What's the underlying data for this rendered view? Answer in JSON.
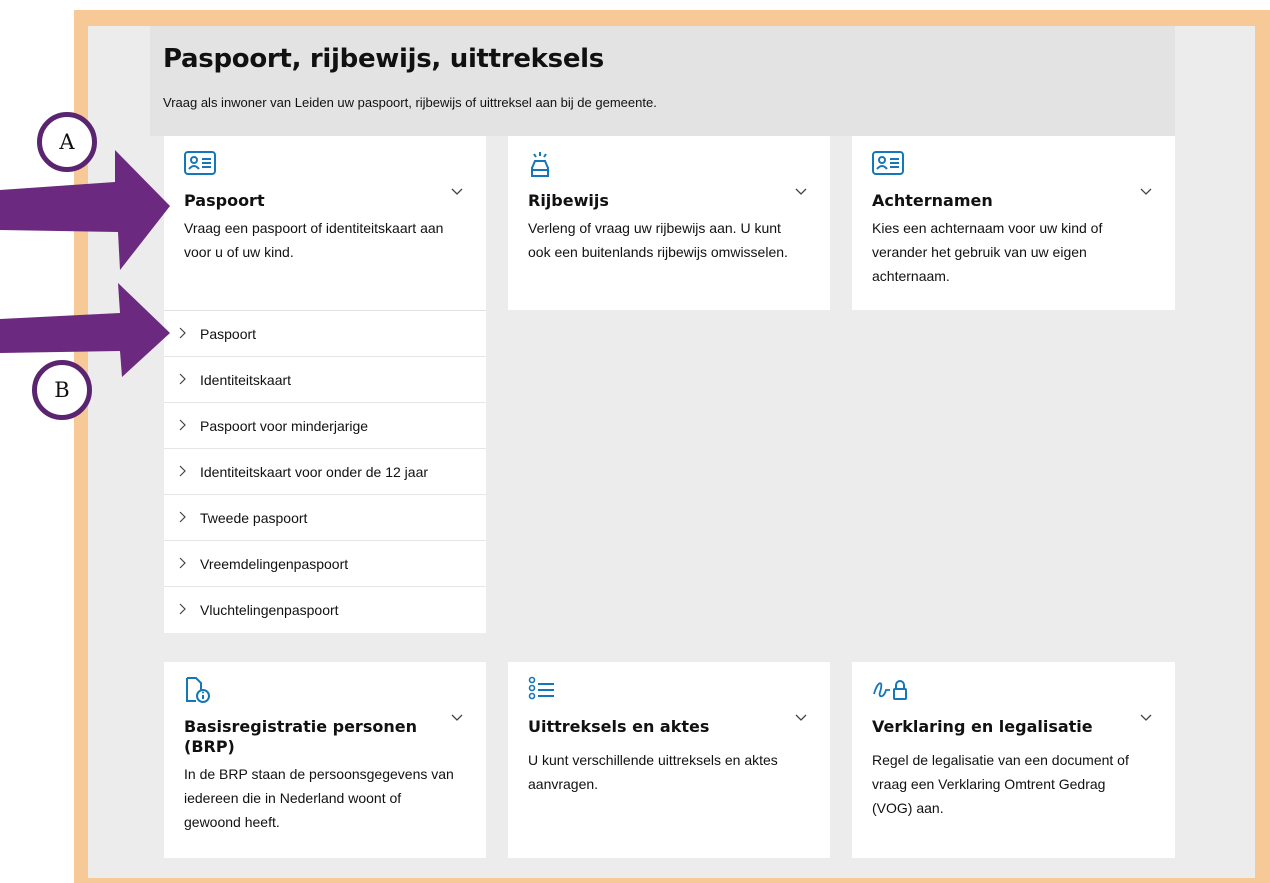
{
  "page": {
    "title": "Paspoort, rijbewijs, uittreksels",
    "subtitle": "Vraag als inwoner van Leiden uw paspoort, rijbewijs of uittreksel aan bij de gemeente."
  },
  "annotations": {
    "badge_a": "A",
    "badge_b": "B",
    "arrow_color": "#6b2a7f",
    "frame_color": "#f6c996"
  },
  "cards": [
    {
      "icon": "id-card-icon",
      "title": "Paspoort",
      "desc": "Vraag een paspoort of identiteitskaart aan voor u of uw kind.",
      "expanded": true
    },
    {
      "icon": "car-icon",
      "title": "Rijbewijs",
      "desc": "Verleng of vraag uw rijbewijs aan. U kunt ook een buitenlands rijbewijs omwisselen.",
      "expanded": false
    },
    {
      "icon": "id-card-icon",
      "title": "Achternamen",
      "desc": "Kies een achternaam voor uw kind of verander het gebruik van uw eigen achternaam.",
      "expanded": false
    },
    {
      "icon": "document-info-icon",
      "title": "Basisregistratie personen (BRP)",
      "desc": "In de BRP staan de persoonsgegevens van iedereen die in Nederland woont of gewoond heeft.",
      "expanded": false
    },
    {
      "icon": "list-icon",
      "title": "Uittreksels en aktes",
      "desc": "U kunt verschillende uittreksels en aktes aanvragen.",
      "expanded": false
    },
    {
      "icon": "signature-lock-icon",
      "title": "Verklaring en legalisatie",
      "desc": "Regel de legalisatie van een document of vraag een Verklaring Omtrent Gedrag (VOG) aan.",
      "expanded": false
    }
  ],
  "paspoort_links": [
    "Paspoort",
    "Identiteitskaart",
    "Paspoort voor minderjarige",
    "Identiteitskaart voor onder de 12 jaar",
    "Tweede paspoort",
    "Vreemdelingenpaspoort",
    "Vluchtelingenpaspoort"
  ]
}
